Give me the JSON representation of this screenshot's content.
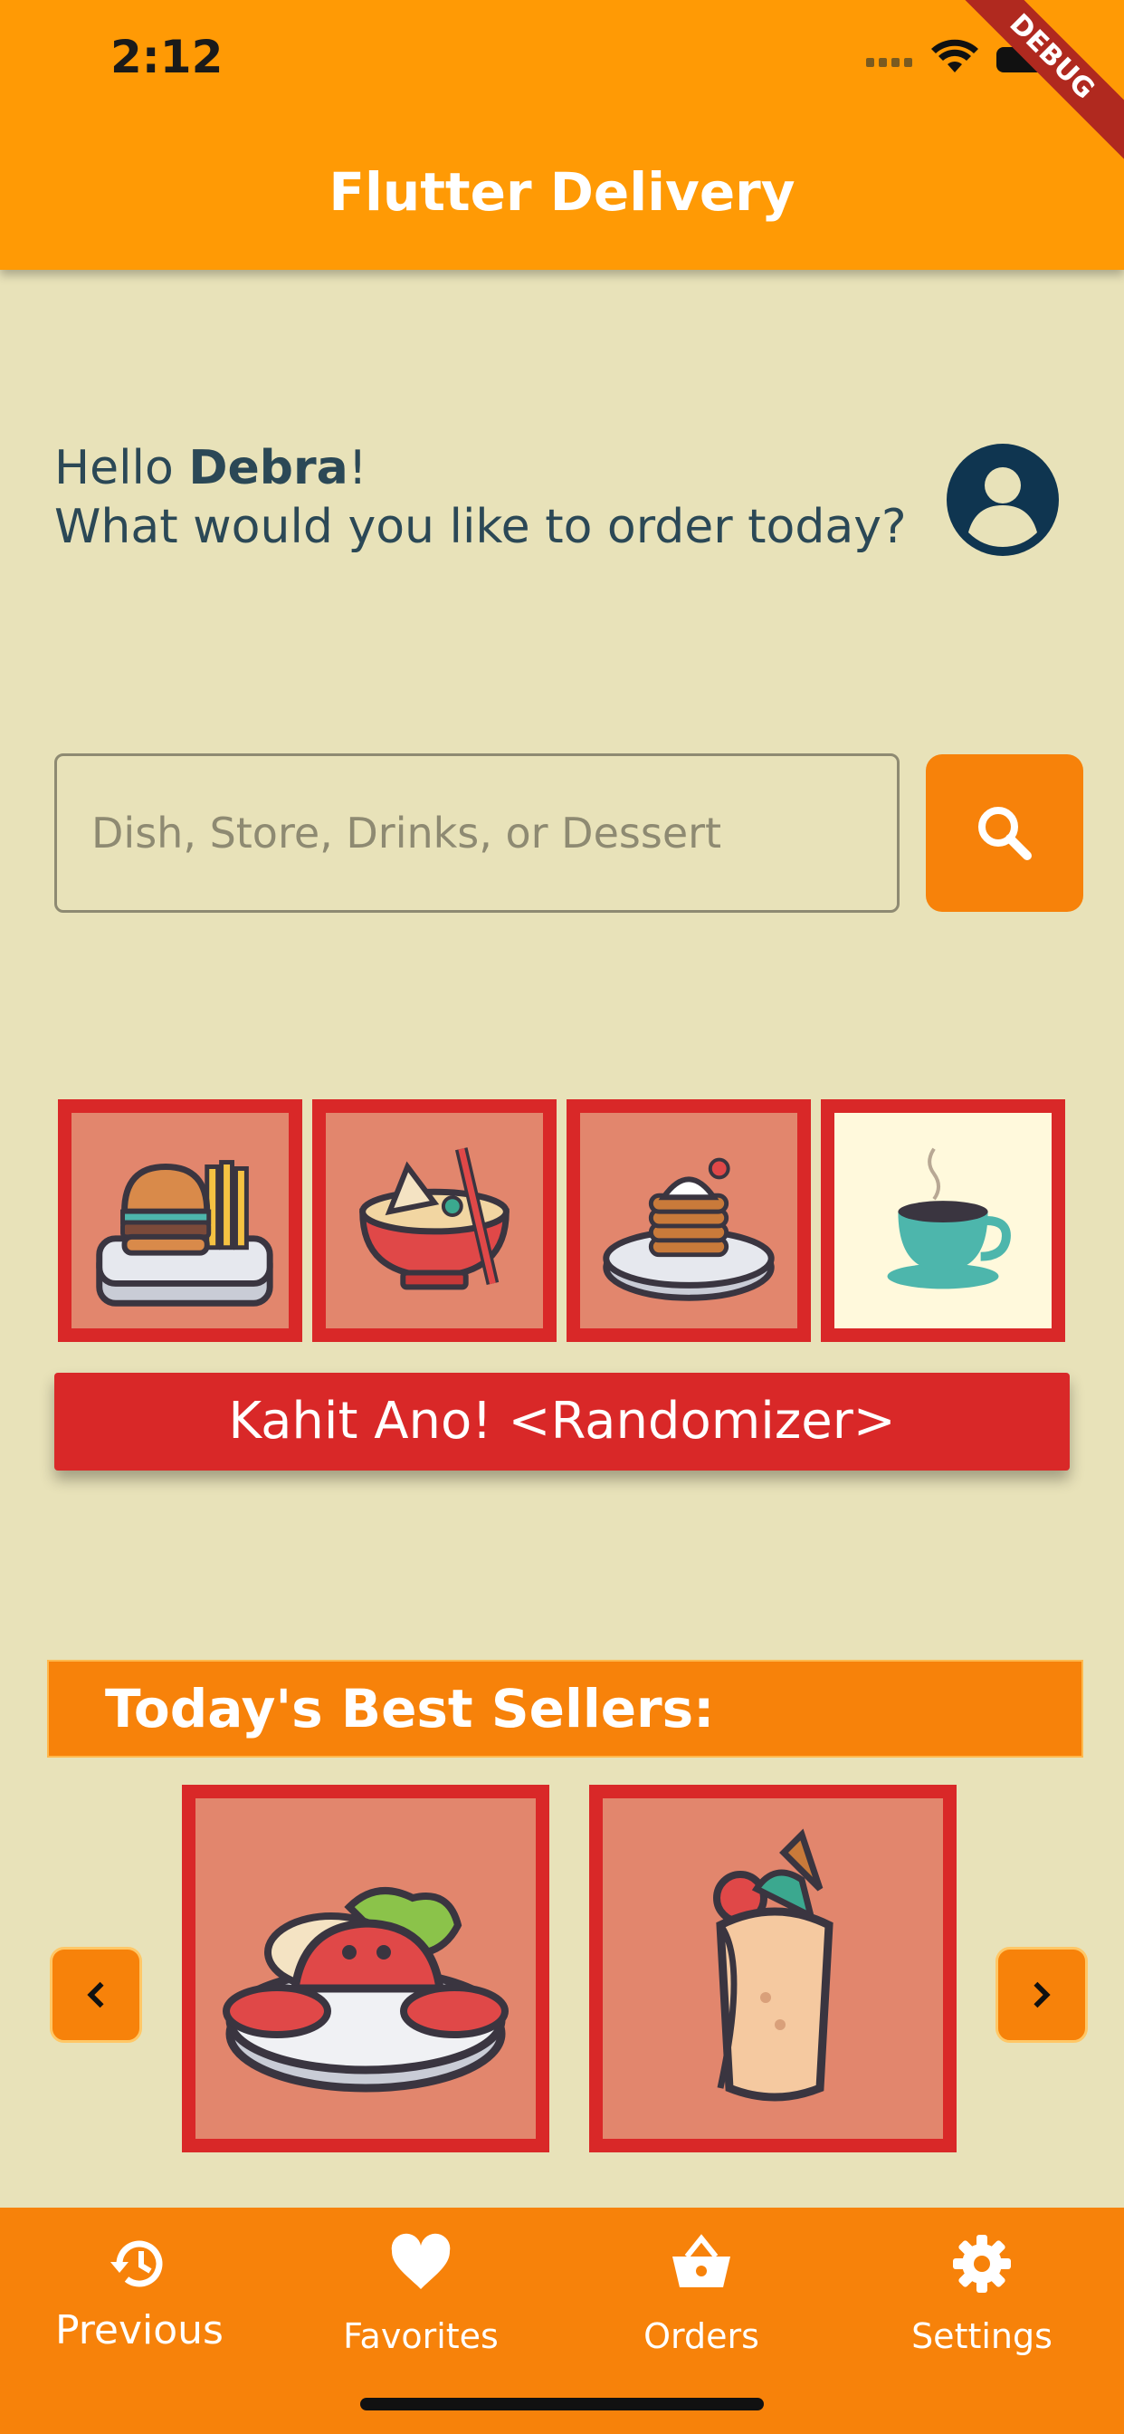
{
  "status_bar": {
    "time": "2:12"
  },
  "debug_banner": "DEBUG",
  "app_bar": {
    "title": "Flutter Delivery"
  },
  "greeting": {
    "hello": "Hello ",
    "name": "Debra",
    "exclaim": "!",
    "question": "What would you like to order today?"
  },
  "search": {
    "placeholder": "Dish, Store, Drinks, or Dessert",
    "value": ""
  },
  "categories": [
    {
      "icon": "burger-fries-icon"
    },
    {
      "icon": "ramen-bowl-icon"
    },
    {
      "icon": "pancake-dessert-icon"
    },
    {
      "icon": "coffee-cup-icon"
    }
  ],
  "randomizer": {
    "label": "Kahit Ano! <Randomizer>"
  },
  "best_sellers": {
    "title": "Today's Best Sellers:",
    "items": [
      {
        "icon": "crab-dish-icon"
      },
      {
        "icon": "burrito-wrap-icon"
      }
    ]
  },
  "bottom_nav": {
    "items": [
      {
        "label": "Previous",
        "icon": "history-icon"
      },
      {
        "label": "Favorites",
        "icon": "heart-icon"
      },
      {
        "label": "Orders",
        "icon": "basket-icon"
      },
      {
        "label": "Settings",
        "icon": "gear-icon"
      }
    ]
  },
  "colors": {
    "primary": "#FF9A05",
    "accent": "#F7820A",
    "red": "#D92828",
    "background": "#E8E2B9",
    "tile": "#E2866D"
  }
}
